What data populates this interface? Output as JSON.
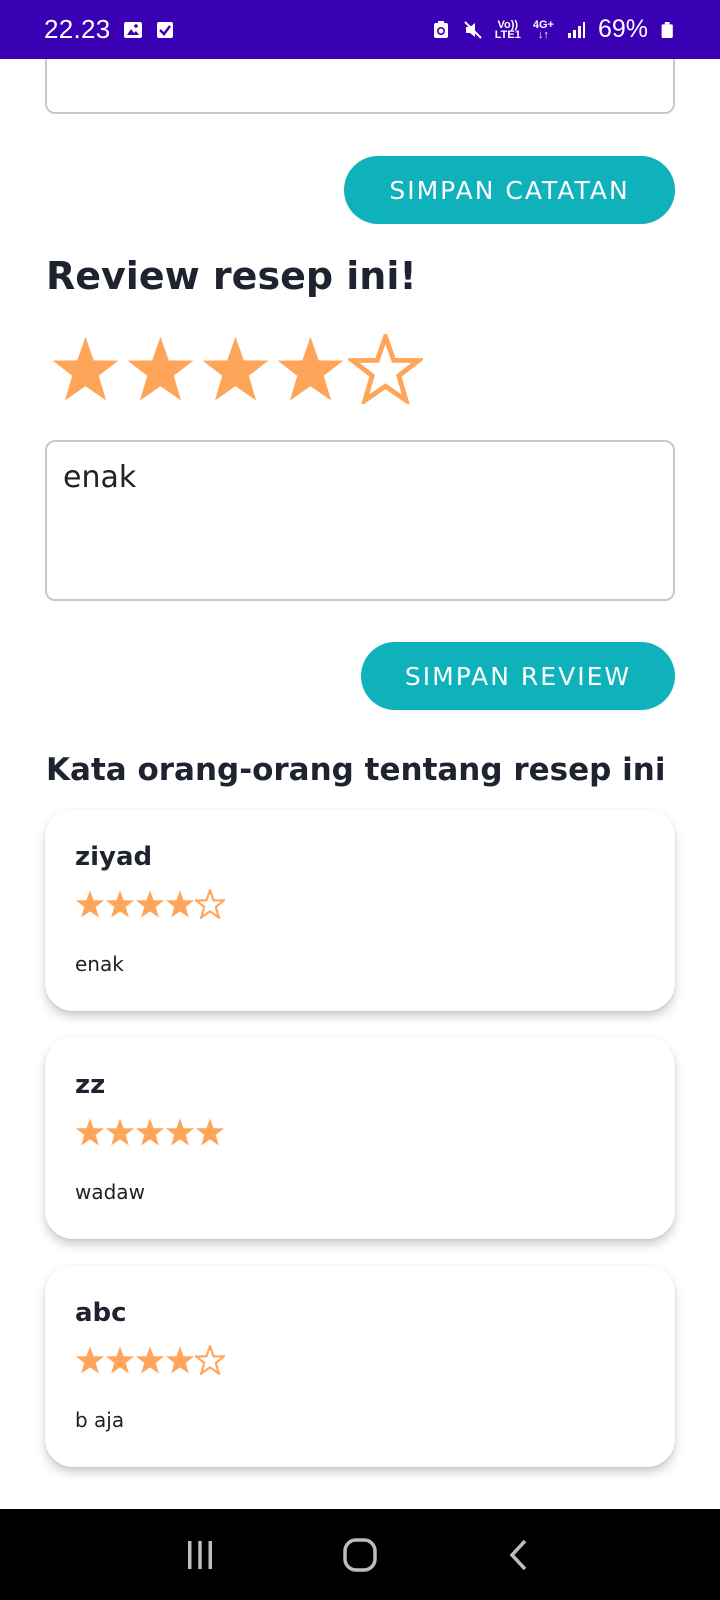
{
  "status_bar": {
    "time": "22.23",
    "network_top": "Vo))",
    "network_bottom": "LTE1",
    "network_type": "4G+",
    "battery_percent": "69%",
    "icons": [
      "image-icon",
      "check-box-icon",
      "data-saver-icon",
      "mute-icon",
      "signal-icon",
      "battery-icon"
    ]
  },
  "notes": {
    "save_button": "SIMPAN CATATAN"
  },
  "review": {
    "title": "Review resep ini!",
    "rating": 4,
    "max_rating": 5,
    "input_value": "enak",
    "save_button": "SIMPAN REVIEW"
  },
  "others": {
    "title": "Kata orang-orang tentang resep ini",
    "reviews": [
      {
        "name": "ziyad",
        "rating": 4,
        "text": "enak"
      },
      {
        "name": "zz",
        "rating": 5,
        "text": "wadaw"
      },
      {
        "name": "abc",
        "rating": 4,
        "text": "b aja"
      }
    ]
  },
  "colors": {
    "status_bar": "#3a00b3",
    "accent": "#0fb1bb",
    "star": "#ffa55a",
    "text": "#1f2330"
  },
  "nav_bar": {
    "icons": [
      "recent-apps-icon",
      "home-icon",
      "back-icon"
    ]
  }
}
